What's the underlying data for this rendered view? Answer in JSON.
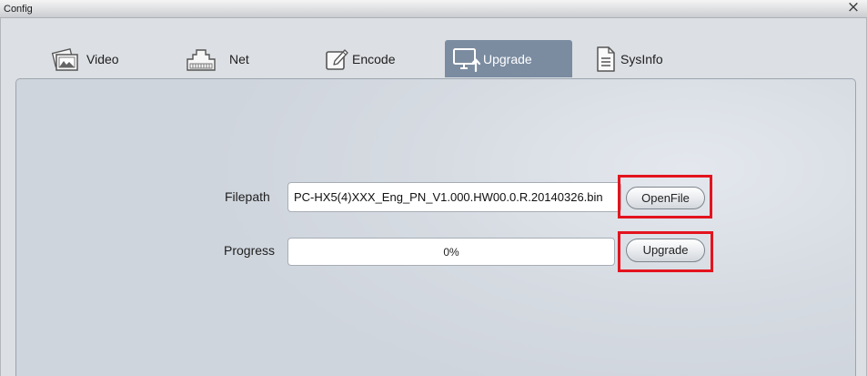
{
  "window": {
    "title": "Config",
    "close_glyph": "×"
  },
  "tabs": [
    {
      "label": "Video",
      "icon": "image-icon",
      "selected": false
    },
    {
      "label": "Net",
      "icon": "network-port-icon",
      "selected": false
    },
    {
      "label": "Encode",
      "icon": "edit-icon",
      "selected": false
    },
    {
      "label": "Upgrade",
      "icon": "monitor-upload-icon",
      "selected": true
    },
    {
      "label": "SysInfo",
      "icon": "document-icon",
      "selected": false
    }
  ],
  "upgrade": {
    "filepath_label": "Filepath",
    "filepath_value": "PC-HX5(4)XXX_Eng_PN_V1.000.HW00.0.R.20140326.bin",
    "open_file_button": "OpenFile",
    "progress_label": "Progress",
    "progress_text": "0%",
    "progress_percent": 0,
    "upgrade_button": "Upgrade"
  },
  "colors": {
    "selected_tab": "#7b8ca1",
    "annotation_highlight": "#e3141e"
  }
}
